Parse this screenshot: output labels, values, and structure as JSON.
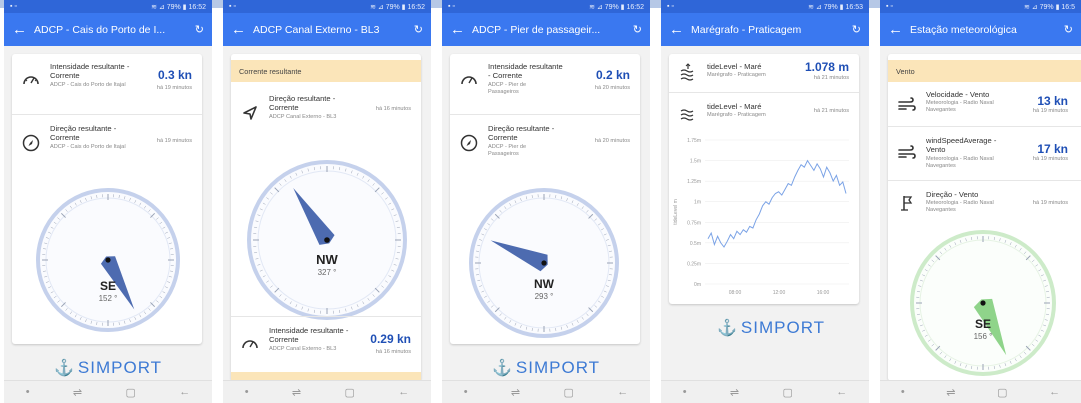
{
  "status": {
    "p1": "≋ ⊿ 79% ▮ 16:52",
    "p2": "≋ ⊿ 79% ▮ 16:52",
    "p3": "≋ ⊿ 79% ▮ 16:52",
    "p4": "≋ ⊿ 79% ▮ 16:53",
    "p5": "≋ ⊿ 79% ▮ 16:5"
  },
  "p1": {
    "title": "ADCP - Cais do Porto de I...",
    "rows": [
      {
        "name": "Intensidade resultante - Corrente",
        "meta": "ADCP - Cais do Porto de Itajaí",
        "value": "0.3 kn",
        "time": "há 19 minutos"
      },
      {
        "name": "Direção resultante - Corrente",
        "meta": "ADCP - Cais do Porto de Itajaí",
        "value": "",
        "time": "há 19 minutos"
      }
    ],
    "compass": {
      "dir": "SE",
      "deg": "152 °",
      "angle": 152
    }
  },
  "p2": {
    "title": "ADCP Canal Externo - BL3",
    "section": "Corrente resultante",
    "rows": [
      {
        "name": "Direção resultante - Corrente",
        "meta": "ADCP Canal Externo - BL3",
        "value": "",
        "time": "há 16 minutos"
      },
      {
        "name": "Intensidade resultante - Corrente",
        "meta": "ADCP Canal Externo - BL3",
        "value": "0.29 kn",
        "time": "há 16 minutos"
      }
    ],
    "compass": {
      "dir": "NW",
      "deg": "327 °",
      "angle": 327
    }
  },
  "p3": {
    "title": "ADCP - Pier de passageir...",
    "rows": [
      {
        "name": "Intensidade resultante - Corrente",
        "meta": "ADCP - Pier de Passageiros",
        "value": "0.2 kn",
        "time": "há 20 minutos"
      },
      {
        "name": "Direção resultante - Corrente",
        "meta": "ADCP - Pier de Passageiros",
        "value": "",
        "time": "há 20 minutos"
      }
    ],
    "compass": {
      "dir": "NW",
      "deg": "293 °",
      "angle": 293
    }
  },
  "p4": {
    "title": "Marégrafo - Praticagem",
    "rows": [
      {
        "name": "tideLevel - Maré",
        "meta": "Marégrafo - Praticagem",
        "value": "1.078 m",
        "time": "há 21 minutos"
      },
      {
        "name": "tideLevel - Maré",
        "meta": "Marégrafo - Praticagem",
        "value": "",
        "time": "há 21 minutos"
      }
    ],
    "chart_data": {
      "type": "line",
      "title": "",
      "xlabel": "",
      "ylabel": "tideLevel m",
      "yticks": [
        "1.75m",
        "1.5m",
        "1.25m",
        "1m",
        "0.75m",
        "0.5m",
        "0.25m",
        "0m"
      ],
      "xticks": [
        "08:00",
        "12:00",
        "16:00"
      ],
      "ylim": [
        0,
        1.75
      ],
      "values": [
        0.55,
        0.62,
        0.48,
        0.58,
        0.5,
        0.45,
        0.52,
        0.6,
        0.55,
        0.64,
        0.6,
        0.66,
        0.63,
        0.7,
        0.68,
        0.78,
        0.85,
        0.95,
        1.0,
        0.97,
        1.05,
        1.1,
        1.12,
        1.08,
        1.15,
        1.22,
        1.2,
        1.3,
        1.38,
        1.45,
        1.42,
        1.5,
        1.44,
        1.38,
        1.46,
        1.4,
        1.3,
        1.42,
        1.35,
        1.25,
        1.32,
        1.2,
        1.24,
        1.1
      ]
    }
  },
  "p5": {
    "title": "Estação meteorológica",
    "section": "Vento",
    "rows": [
      {
        "name": "Velocidade - Vento",
        "meta": "Meteorologia - Radio Naval Navegantes",
        "value": "13 kn",
        "time": "há 19 minutos"
      },
      {
        "name": "windSpeedAverage - Vento",
        "meta": "Meteorologia - Radio Naval Navegantes",
        "value": "17 kn",
        "time": "há 19 minutos"
      },
      {
        "name": "Direção - Vento",
        "meta": "Meteorologia - Radio Naval Navegantes",
        "value": "",
        "time": "há 19 minutos"
      }
    ],
    "compass": {
      "dir": "SE",
      "deg": "156 °",
      "angle": 156
    }
  },
  "logo": "SIMPORT",
  "nav": {
    "dot": "•",
    "recent": "⇌",
    "home": "▢",
    "back": "←"
  },
  "icons": {
    "back": "←",
    "refresh": "↻"
  },
  "colors": {
    "appbar": "#3a78f0",
    "needle_blue": "#4d6bb0",
    "needle_green": "#8fd48a",
    "compass_ring_blue": "#c5d1ec",
    "compass_ring_green": "#cdebc9",
    "value": "#1f4fb5"
  }
}
